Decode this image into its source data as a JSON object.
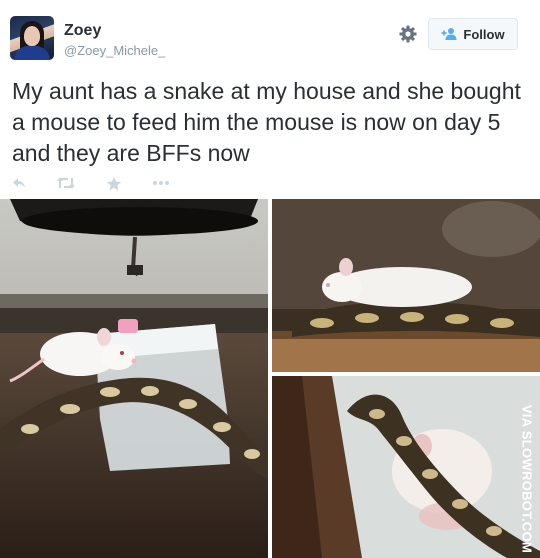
{
  "user": {
    "display_name": "Zoey",
    "handle": "@Zoey_Michele_"
  },
  "header": {
    "follow_label": "Follow"
  },
  "tweet": {
    "text": "My aunt has a snake at my house and she bought a mouse to feed him the mouse is now on day 5 and they are BFFs now"
  },
  "actions": {
    "reply_icon": "reply-icon",
    "retweet_icon": "retweet-icon",
    "favorite_icon": "star-icon",
    "more_icon": "more-icon"
  },
  "photos": {
    "watermark": "VIA SLOWROBOT.COM"
  },
  "colors": {
    "follow_accent": "#55acee",
    "text": "#292f33",
    "muted": "#8899a6",
    "action_icons": "#ccd6dd"
  }
}
